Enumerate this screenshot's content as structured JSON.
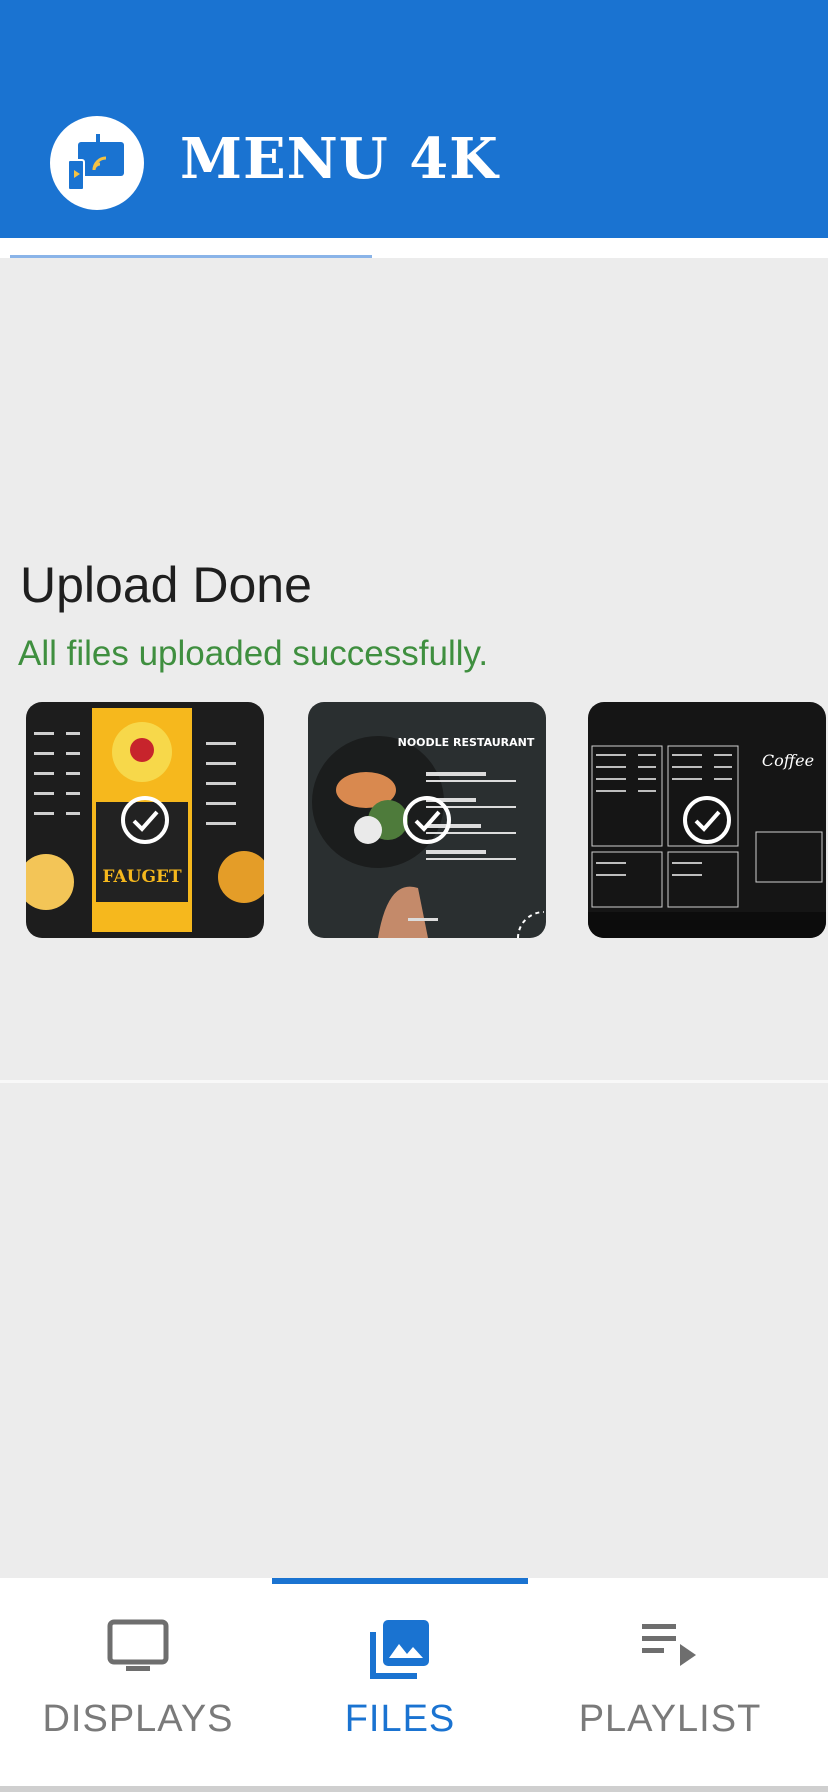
{
  "header": {
    "brand": "MENU 4K",
    "color": "#1a73d1"
  },
  "upload": {
    "title": "Upload Done",
    "message": "All files uploaded successfully.",
    "message_color": "#3f8f3f",
    "thumbnails": [
      {
        "name": "thumb-fauget-menu",
        "text": "FAUGET",
        "status": "check-icon"
      },
      {
        "name": "thumb-noodle-restaurant",
        "text": "NOODLE RESTAURANT",
        "status": "check-icon"
      },
      {
        "name": "thumb-coffee-menu",
        "text": "Coffee",
        "status": "check-icon"
      }
    ]
  },
  "bottom_nav": {
    "items": [
      {
        "label": "DISPLAYS",
        "icon": "monitor-icon",
        "active": false
      },
      {
        "label": "FILES",
        "icon": "photo-library-icon",
        "active": true
      },
      {
        "label": "PLAYLIST",
        "icon": "playlist-play-icon",
        "active": false
      }
    ]
  }
}
